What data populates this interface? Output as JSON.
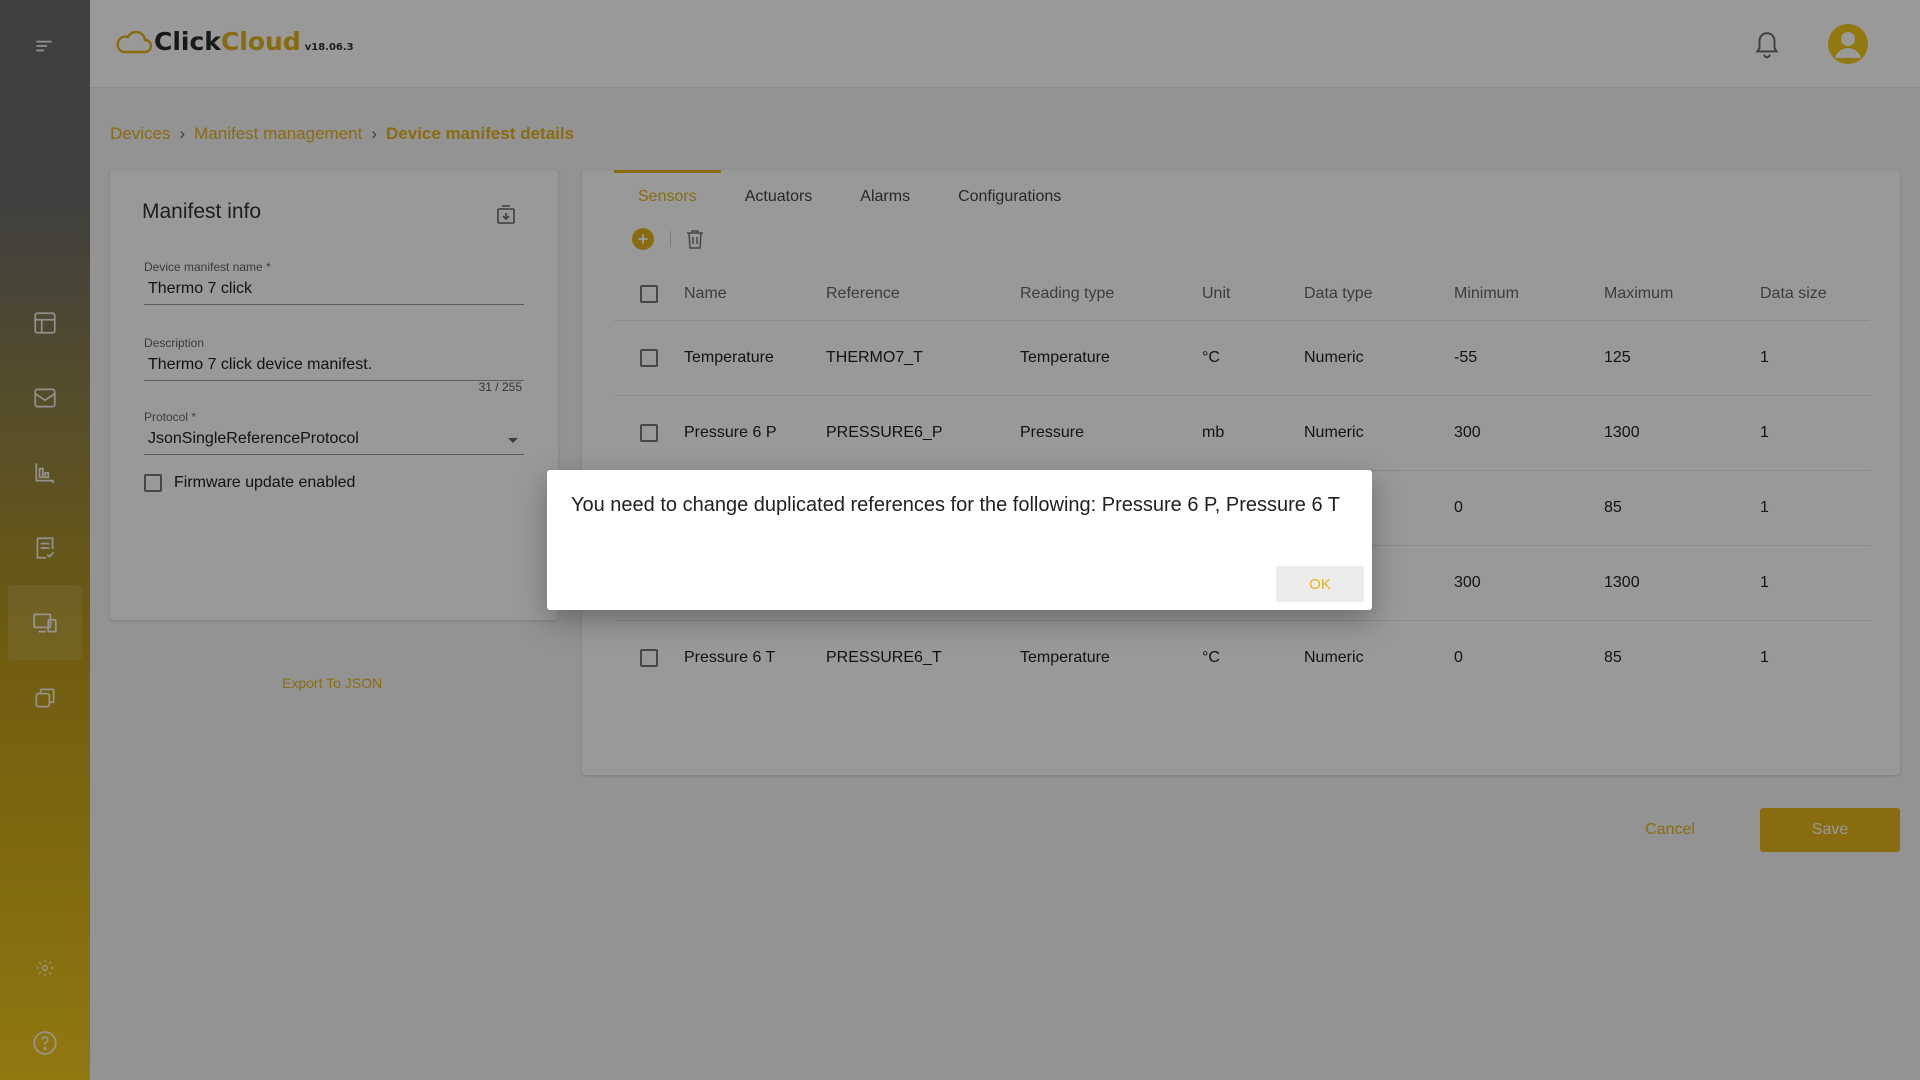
{
  "app": {
    "logo_click": "Click",
    "logo_cloud": "Cloud",
    "version": "v18.06.3"
  },
  "sidebar": {
    "items": [
      {
        "icon": "menu-icon"
      },
      {
        "icon": "dashboard-icon"
      },
      {
        "icon": "mail-icon"
      },
      {
        "icon": "charts-icon"
      },
      {
        "icon": "tasks-icon"
      },
      {
        "icon": "devices-icon",
        "active": true
      },
      {
        "icon": "copy-icon"
      },
      {
        "icon": "gear-icon"
      },
      {
        "icon": "help-icon"
      }
    ]
  },
  "breadcrumb": {
    "items": [
      "Devices",
      "Manifest management",
      "Device manifest details"
    ]
  },
  "manifest_info": {
    "title": "Manifest info",
    "name_label": "Device manifest name",
    "name_value": "Thermo 7 click",
    "description_label": "Description",
    "description_value": "Thermo 7 click device manifest.",
    "description_counter": "31 / 255",
    "protocol_label": "Protocol",
    "protocol_value": "JsonSingleReferenceProtocol",
    "firmware_label": "Firmware update enabled",
    "export_link": "Export To JSON"
  },
  "tabs": [
    "Sensors",
    "Actuators",
    "Alarms",
    "Configurations"
  ],
  "table": {
    "headers": [
      "Name",
      "Reference",
      "Reading type",
      "Unit",
      "Data type",
      "Minimum",
      "Maximum",
      "Data size"
    ],
    "rows": [
      [
        "Temperature",
        "THERMO7_T",
        "Temperature",
        "°C",
        "Numeric",
        "-55",
        "125",
        "1"
      ],
      [
        "Pressure 6 P",
        "PRESSURE6_P",
        "Pressure",
        "mb",
        "Numeric",
        "300",
        "1300",
        "1"
      ],
      [
        "",
        "",
        "",
        "",
        "",
        "0",
        "85",
        "1"
      ],
      [
        "",
        "",
        "",
        "",
        "",
        "300",
        "1300",
        "1"
      ],
      [
        "Pressure 6 T",
        "PRESSURE6_T",
        "Temperature",
        "°C",
        "Numeric",
        "0",
        "85",
        "1"
      ]
    ]
  },
  "buttons": {
    "cancel": "Cancel",
    "save": "Save"
  },
  "dialog": {
    "message": "You need to change duplicated references for the following: Pressure 6 P, Pressure 6 T",
    "ok": "OK"
  },
  "colors": {
    "accent": "#e5b51b"
  }
}
